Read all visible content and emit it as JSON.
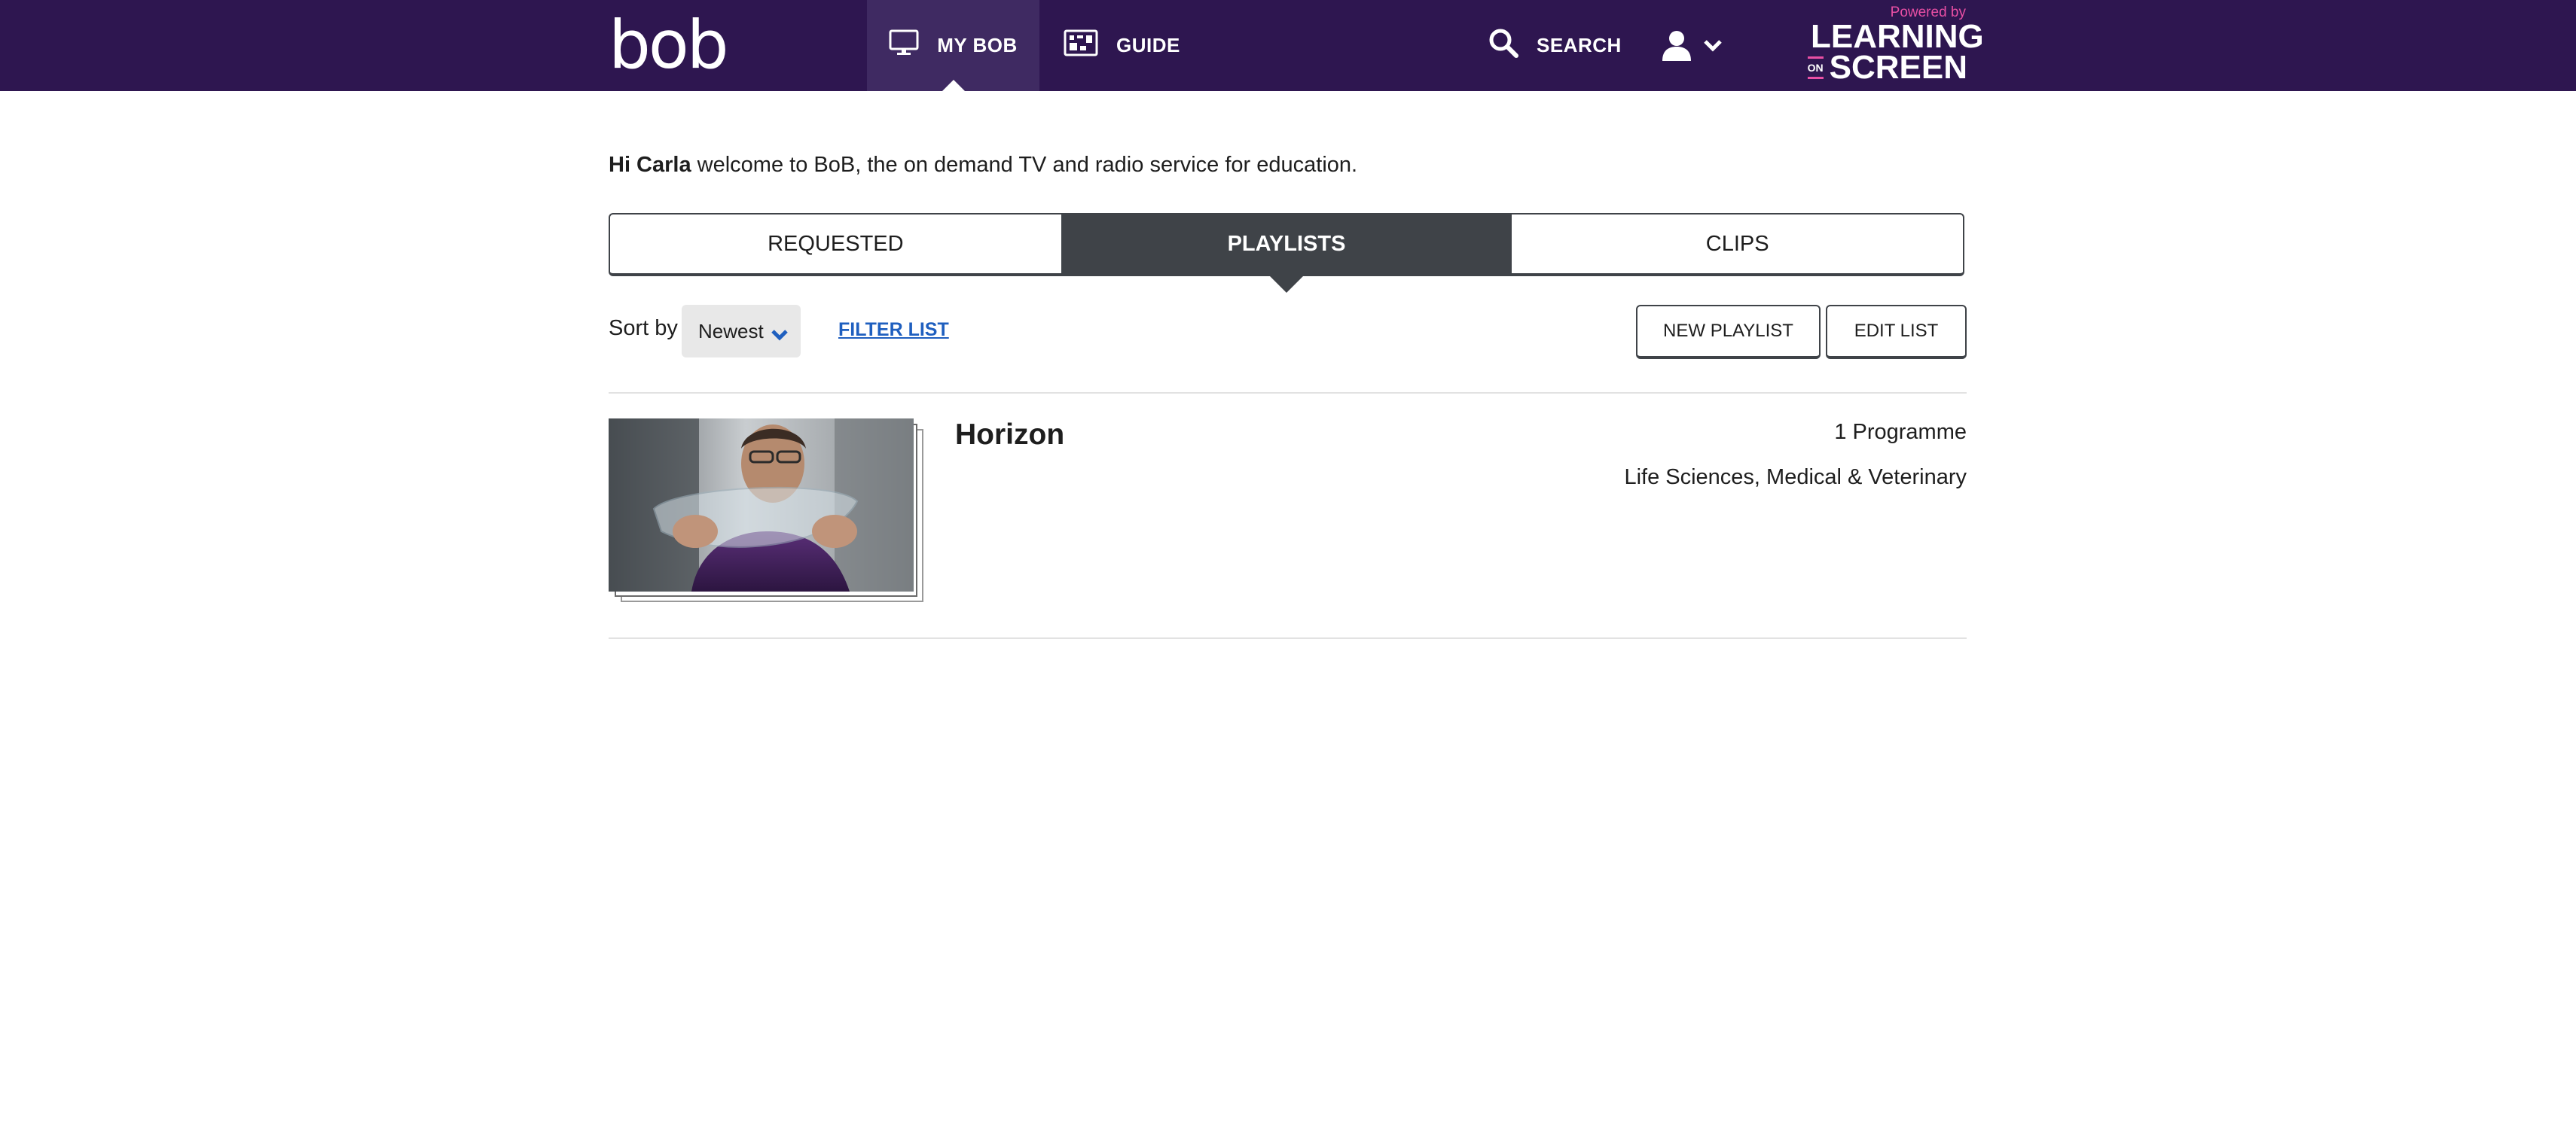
{
  "header": {
    "logo_text": "bob",
    "nav": {
      "my_bob": "MY BOB",
      "guide": "GUIDE",
      "search": "SEARCH"
    },
    "powered_by": {
      "small": "Powered by",
      "line1": "LEARNING",
      "on": "ON",
      "line2": "SCREEN"
    },
    "colors": {
      "background": "#2e1650",
      "active_nav": "#3f2a62",
      "accent": "#e84fa4"
    }
  },
  "welcome": {
    "name": "Hi Carla",
    "message": " welcome to BoB, the on demand TV and radio service for education."
  },
  "tabs": [
    {
      "label": "REQUESTED",
      "active": false
    },
    {
      "label": "PLAYLISTS",
      "active": true
    },
    {
      "label": "CLIPS",
      "active": false
    }
  ],
  "toolbar": {
    "sort_label": "Sort by",
    "sort_value": "Newest",
    "filter_label": "FILTER LIST",
    "new_playlist": "NEW PLAYLIST",
    "edit_list": "EDIT LIST"
  },
  "playlists": [
    {
      "title": "Horizon",
      "count": "1 Programme",
      "subject": "Life Sciences, Medical & Veterinary"
    }
  ],
  "icons": {
    "my_bob": "monitor-icon",
    "guide": "guide-grid-icon",
    "search": "search-icon",
    "user": "user-icon",
    "dropdown": "chevron-down-icon"
  }
}
